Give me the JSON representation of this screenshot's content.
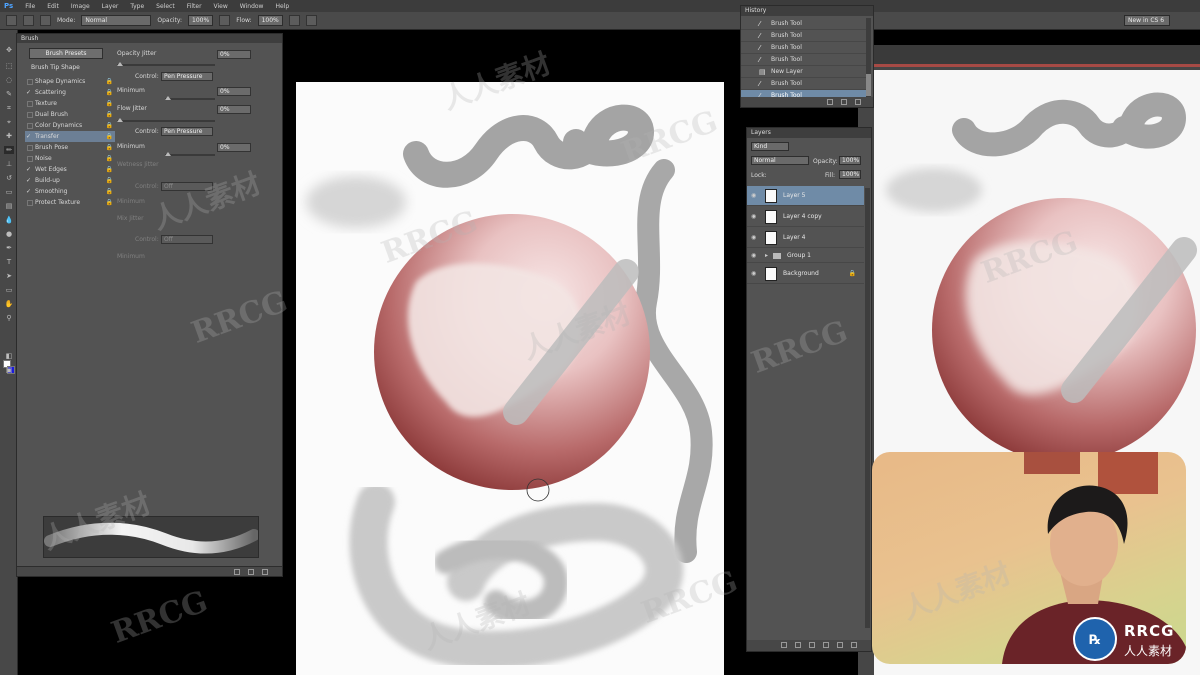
{
  "app": {
    "logo": "Ps",
    "menu": [
      "File",
      "Edit",
      "Image",
      "Layer",
      "Type",
      "Select",
      "Filter",
      "View",
      "Window",
      "Help"
    ],
    "workspace": "New in CS 6"
  },
  "options_bar": {
    "mode_label": "Mode:",
    "mode_value": "Normal",
    "opacity_label": "Opacity:",
    "opacity_value": "100%",
    "flow_label": "Flow:",
    "flow_value": "100%"
  },
  "colors": {
    "foreground": "#ffffff",
    "background": "#1b1bd9",
    "selection": "#6f8ba7"
  },
  "brush_panel": {
    "tab": "Brush",
    "presets_button": "Brush Presets",
    "tip_shape": "Brush Tip Shape",
    "categories": [
      {
        "label": "Shape Dynamics",
        "checked": false
      },
      {
        "label": "Scattering",
        "checked": true
      },
      {
        "label": "Texture",
        "checked": false
      },
      {
        "label": "Dual Brush",
        "checked": false
      },
      {
        "label": "Color Dynamics",
        "checked": false
      },
      {
        "label": "Transfer",
        "checked": true,
        "selected": true
      },
      {
        "label": "Brush Pose",
        "checked": false
      },
      {
        "label": "Noise",
        "checked": false
      },
      {
        "label": "Wet Edges",
        "checked": true
      },
      {
        "label": "Build-up",
        "checked": true
      },
      {
        "label": "Smoothing",
        "checked": true
      },
      {
        "label": "Protect Texture",
        "checked": false
      }
    ],
    "controls": {
      "opacity_jitter_label": "Opacity Jitter",
      "opacity_jitter_value": "0%",
      "control_label": "Control:",
      "control_value": "Pen Pressure",
      "minimum_label": "Minimum",
      "minimum_value": "0%",
      "flow_jitter_label": "Flow Jitter",
      "flow_jitter_value": "0%",
      "control2_label": "Control:",
      "control2_value": "Pen Pressure",
      "minimum2_label": "Minimum",
      "minimum2_value": "0%",
      "wetness_jitter_label": "Wetness Jitter",
      "control3_label": "Control:",
      "control3_value": "Off",
      "minimum3_label": "Minimum",
      "mix_jitter_label": "Mix Jitter",
      "control4_label": "Control:",
      "control4_value": "Off",
      "minimum4_label": "Minimum"
    }
  },
  "history_panel": {
    "tab": "History",
    "items": [
      {
        "label": "Brush Tool",
        "icon": "brush-icon"
      },
      {
        "label": "Brush Tool",
        "icon": "brush-icon"
      },
      {
        "label": "Brush Tool",
        "icon": "brush-icon"
      },
      {
        "label": "Brush Tool",
        "icon": "brush-icon"
      },
      {
        "label": "New Layer",
        "icon": "new-layer-icon"
      },
      {
        "label": "Brush Tool",
        "icon": "brush-icon"
      },
      {
        "label": "Brush Tool",
        "icon": "brush-icon",
        "selected": true
      }
    ]
  },
  "layers_panel": {
    "tab": "Layers",
    "kind_value": "Kind",
    "blend_value": "Normal",
    "opacity_label": "Opacity:",
    "opacity_value": "100%",
    "lock_label": "Lock:",
    "fill_label": "Fill:",
    "fill_value": "100%",
    "layers": [
      {
        "name": "Layer 5",
        "selected": true
      },
      {
        "name": "Layer 4 copy"
      },
      {
        "name": "Layer 4"
      },
      {
        "name": "Group 1",
        "group": true
      },
      {
        "name": "Background",
        "locked": true
      }
    ]
  },
  "watermark": {
    "latin": "RRCG",
    "chinese": "人人素材"
  },
  "brand_logo": {
    "name": "RRCG",
    "subtitle": "人人素材"
  }
}
